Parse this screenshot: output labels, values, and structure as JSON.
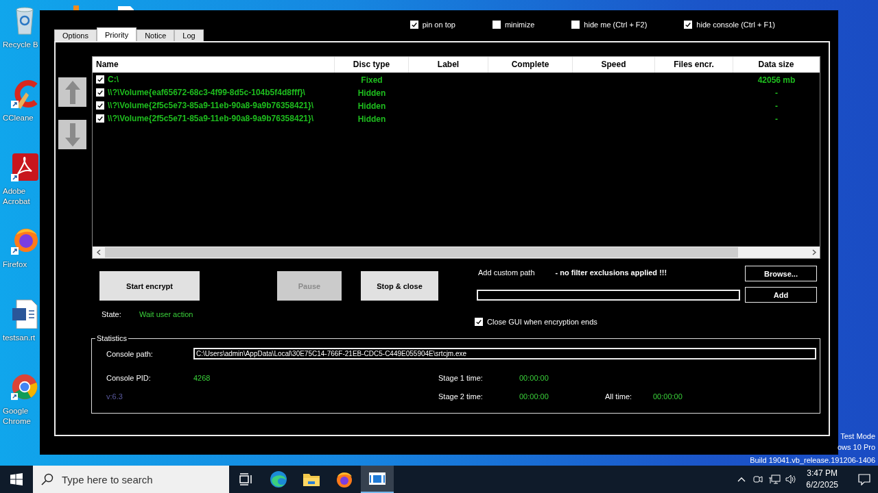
{
  "desktop": {
    "icons": [
      {
        "kind": "bin",
        "lines": [
          "Recycle B"
        ]
      },
      {
        "kind": "cleaner",
        "lines": [
          "CCleane"
        ]
      },
      {
        "kind": "pdf",
        "lines": [
          "Adobe",
          "Acrobat"
        ]
      },
      {
        "kind": "fox",
        "lines": [
          "Firefox"
        ]
      },
      {
        "kind": "doc",
        "lines": [
          "testsan.rt"
        ]
      },
      {
        "kind": "chrome",
        "lines": [
          "Google",
          "Chrome"
        ]
      }
    ],
    "system_text": [
      "Test Mode",
      "ows 10 Pro",
      "Build 19041.vb_release.191206-1406"
    ]
  },
  "window": {
    "tabs": [
      {
        "label": "Options",
        "selected": false
      },
      {
        "label": "Priority",
        "selected": true
      },
      {
        "label": "Notice",
        "selected": false
      },
      {
        "label": "Log",
        "selected": false
      }
    ],
    "options": [
      {
        "label": "pin on top",
        "checked": true
      },
      {
        "label": "minimize",
        "checked": false
      },
      {
        "label": "hide me (Ctrl + F2)",
        "checked": false
      },
      {
        "label": "hide console (Ctrl + F1)",
        "checked": true
      }
    ],
    "table": {
      "columns": [
        "Name",
        "Disc type",
        "Label",
        "Complete",
        "Speed",
        "Files encr.",
        "Data size"
      ],
      "rows": [
        {
          "checked": true,
          "name": "C:\\",
          "disc_type": "Fixed",
          "data_size": "42056 mb"
        },
        {
          "checked": true,
          "name": "\\\\?\\Volume{eaf65672-68c3-4f99-8d5c-104b5f4d8fff}\\",
          "disc_type": "Hidden",
          "data_size": "-"
        },
        {
          "checked": true,
          "name": "\\\\?\\Volume{2f5c5e73-85a9-11eb-90a8-9a9b76358421}\\",
          "disc_type": "Hidden",
          "data_size": "-"
        },
        {
          "checked": true,
          "name": "\\\\?\\Volume{2f5c5e71-85a9-11eb-90a8-9a9b76358421}\\",
          "disc_type": "Hidden",
          "data_size": "-"
        }
      ]
    },
    "buttons": [
      {
        "label": "Start encrypt",
        "disabled": false
      },
      {
        "label": "Pause",
        "disabled": true
      },
      {
        "label": "Stop & close",
        "disabled": false
      }
    ],
    "state": {
      "label": "State:",
      "value": "Wait user action"
    },
    "custom_path": {
      "label": "Add custom path",
      "warning": "- no filter exclusions applied !!!",
      "browse": "Browse...",
      "add": "Add"
    },
    "close_gui": {
      "label": "Close GUI when encryption ends",
      "checked": true
    },
    "statistics": {
      "title": "Statistics",
      "console_path_label": "Console path:",
      "console_path": "C:\\Users\\admin\\AppData\\Local\\30E75C14-766F-21EB-CDC5-C449E055904E\\srtcjm.exe",
      "console_pid_label": "Console PID:",
      "console_pid": "4268",
      "version": "v:6.3",
      "stage1_label": "Stage 1 time:",
      "stage1": "00:00:00",
      "stage2_label": "Stage 2 time:",
      "stage2": "00:00:00",
      "all_time_label": "All time:",
      "all_time": "00:00:00"
    }
  },
  "taskbar": {
    "search_placeholder": "Type here to search",
    "apps": [
      {
        "kind": "taskview",
        "selected": false
      },
      {
        "kind": "edge",
        "selected": false
      },
      {
        "kind": "folder",
        "selected": false
      },
      {
        "kind": "fox",
        "selected": false
      },
      {
        "kind": "window",
        "selected": true
      }
    ],
    "clock": {
      "time": "3:47 PM",
      "date": "6/2/2025"
    }
  }
}
